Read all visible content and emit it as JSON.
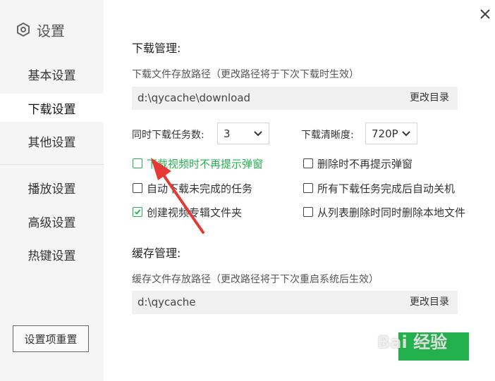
{
  "sidebar": {
    "title": "设置",
    "items": [
      {
        "label": "基本设置"
      },
      {
        "label": "下载设置"
      },
      {
        "label": "其他设置"
      },
      {
        "label": "播放设置"
      },
      {
        "label": "高级设置"
      },
      {
        "label": "热键设置"
      }
    ],
    "active_index": 1,
    "reset_label": "设置项重置"
  },
  "download": {
    "section_title": "下载管理:",
    "path_hint": "下载文件存放路径（更改路径将于下次下载时生效）",
    "path_value": "d:\\qycache\\download",
    "change_dir_label": "更改目录",
    "concurrent_label": "同时下载任务数:",
    "concurrent_value": "3",
    "quality_label": "下载清晰度:",
    "quality_value": "720P",
    "checkboxes": [
      {
        "label": "下载视频时不再提示弹窗",
        "checked": false,
        "highlighted": true
      },
      {
        "label": "删除时不再提示弹窗",
        "checked": false
      },
      {
        "label": "自动下载未完成的任务",
        "checked": false
      },
      {
        "label": "所有下载任务完成后自动关机",
        "checked": false
      },
      {
        "label": "创建视频专辑文件夹",
        "checked": true
      },
      {
        "label": "从列表删除时同时删除本地文件",
        "checked": false
      }
    ]
  },
  "cache": {
    "section_title": "缓存管理:",
    "path_hint": "缓存文件存放路径（更改路径将于下次重启系统后生效）",
    "path_value": "d:\\qycache",
    "change_dir_label": "更改目录"
  },
  "watermark": "Bai 经验",
  "colors": {
    "accent": "#22b14c",
    "arrow": "#e53935",
    "sidebar_bg": "#f5f5f5",
    "path_bg": "#f0f0f0"
  }
}
